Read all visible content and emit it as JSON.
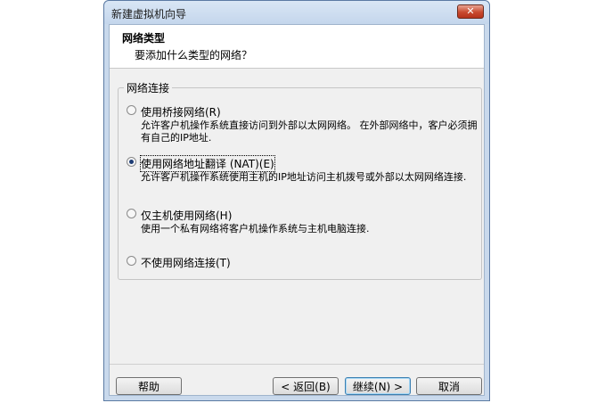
{
  "window": {
    "title": "新建虚拟机向导",
    "close_glyph": "✕"
  },
  "header": {
    "title": "网络类型",
    "subtitle": "要添加什么类型的网络？"
  },
  "group": {
    "legend": "网络连接"
  },
  "options": [
    {
      "label": "使用桥接网络(R)",
      "description": "允许客户机操作系统直接访问到外部以太网网络。 在外部网络中，客户必须拥有自己的IP地址.",
      "selected": false
    },
    {
      "label": "使用网络地址翻译 (NAT)(E)",
      "description": "允许客户机操作系统使用主机的IP地址访问主机拨号或外部以太网网络连接.",
      "selected": true
    },
    {
      "label": "仅主机使用网络(H)",
      "description": "使用一个私有网络将客户机操作系统与主机电脑连接.",
      "selected": false
    },
    {
      "label": "不使用网络连接(T)",
      "description": "",
      "selected": false
    }
  ],
  "buttons": {
    "help": "帮助",
    "back": "< 返回(B)",
    "next": "继续(N) >",
    "cancel": "取消"
  }
}
